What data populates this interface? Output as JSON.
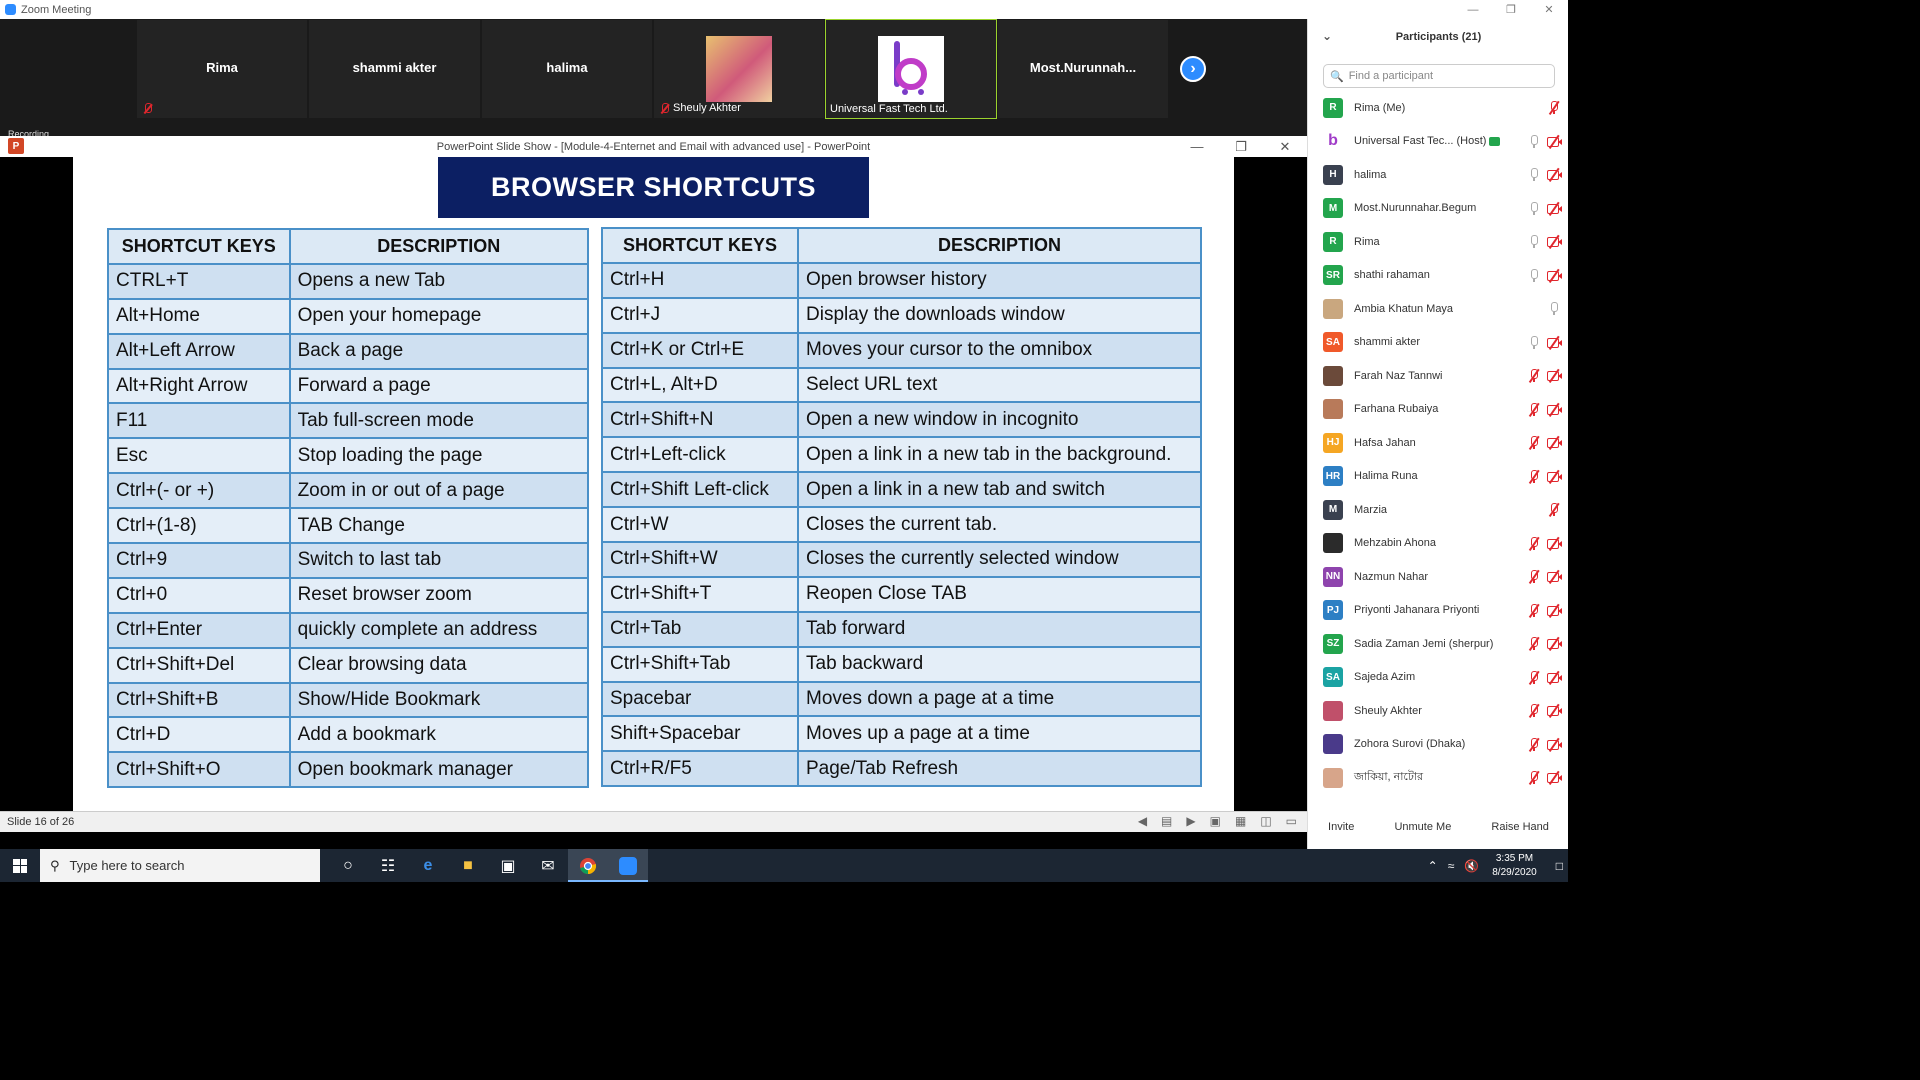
{
  "zoom": {
    "window_title": "Zoom Meeting",
    "recording_label": "Recording",
    "next_icon": "chevron-right-icon",
    "tiles": [
      {
        "name": "Rima",
        "muted": true
      },
      {
        "name": "shammi akter",
        "muted": false
      },
      {
        "name": "halima",
        "muted": false
      },
      {
        "name": "Sheuly Akhter",
        "muted": true,
        "has_photo": true
      },
      {
        "name": "Universal Fast Tech Ltd.",
        "muted": false,
        "has_logo": true,
        "active_speaker": true
      },
      {
        "name": "Most.Nurunnah...",
        "muted": false
      }
    ]
  },
  "powerpoint": {
    "window_title": "PowerPoint Slide Show - [Module-4-Enternet and Email with advanced use] - PowerPoint",
    "status": "Slide 16 of 26",
    "slide": {
      "title": "BROWSER SHORTCUTS",
      "header_keys": "SHORTCUT KEYS",
      "header_desc": "DESCRIPTION",
      "left_rows": [
        [
          "CTRL+T",
          "Opens a new Tab"
        ],
        [
          "Alt+Home",
          "Open your homepage"
        ],
        [
          "Alt+Left Arrow",
          "Back a page"
        ],
        [
          "Alt+Right Arrow",
          "Forward a page"
        ],
        [
          "F11",
          "Tab full-screen mode"
        ],
        [
          "Esc",
          "Stop loading the page"
        ],
        [
          "Ctrl+(- or +)",
          "Zoom in or out of a page"
        ],
        [
          "Ctrl+(1-8)",
          "TAB Change"
        ],
        [
          "Ctrl+9",
          "Switch to last tab"
        ],
        [
          "Ctrl+0",
          "Reset browser zoom"
        ],
        [
          "Ctrl+Enter",
          "quickly complete an address"
        ],
        [
          "Ctrl+Shift+Del",
          "Clear browsing data"
        ],
        [
          "Ctrl+Shift+B",
          "Show/Hide Bookmark"
        ],
        [
          "Ctrl+D",
          "Add a bookmark"
        ],
        [
          "Ctrl+Shift+O",
          "Open bookmark manager"
        ]
      ],
      "right_rows": [
        [
          "Ctrl+H",
          "Open browser history"
        ],
        [
          "Ctrl+J",
          "Display the downloads window"
        ],
        [
          "Ctrl+K or Ctrl+E",
          "Moves your cursor to the omnibox"
        ],
        [
          "Ctrl+L, Alt+D",
          "Select URL text"
        ],
        [
          "Ctrl+Shift+N",
          "Open a new window in incognito"
        ],
        [
          "Ctrl+Left-click",
          "Open a link in a new tab in the background."
        ],
        [
          "Ctrl+Shift Left-click",
          "Open a link in a new tab and switch"
        ],
        [
          "Ctrl+W",
          "Closes the current tab."
        ],
        [
          "Ctrl+Shift+W",
          "Closes the currently selected window"
        ],
        [
          "Ctrl+Shift+T",
          "Reopen Close TAB"
        ],
        [
          "Ctrl+Tab",
          "Tab forward"
        ],
        [
          "Ctrl+Shift+Tab",
          "Tab backward"
        ],
        [
          "Spacebar",
          "Moves down a page at a time"
        ],
        [
          "Shift+Spacebar",
          "Moves up a page at a time"
        ],
        [
          "Ctrl+R/F5",
          "Page/Tab Refresh"
        ]
      ]
    }
  },
  "participants": {
    "title": "Participants (21)",
    "search_placeholder": "Find a participant",
    "list": [
      {
        "name": "Rima (Me)",
        "initials": "R",
        "color": "#23a54d",
        "mic": "muted",
        "cam": "none"
      },
      {
        "name": "Universal Fast Tec... (Host)",
        "initials": "b",
        "color": "#ffffff",
        "mic": "on",
        "cam": "off",
        "host": true
      },
      {
        "name": "halima",
        "initials": "H",
        "color": "#3a4150",
        "mic": "on",
        "cam": "off"
      },
      {
        "name": "Most.Nurunnahar.Begum",
        "initials": "M",
        "color": "#23a54d",
        "mic": "on",
        "cam": "off"
      },
      {
        "name": "Rima",
        "initials": "R",
        "color": "#23a54d",
        "mic": "on",
        "cam": "off"
      },
      {
        "name": "shathi rahaman",
        "initials": "SR",
        "color": "#23a54d",
        "mic": "on",
        "cam": "off"
      },
      {
        "name": "Ambia Khatun Maya",
        "initials": "",
        "color": "#c9a77f",
        "mic": "on",
        "cam": "none"
      },
      {
        "name": "shammi akter",
        "initials": "SA",
        "color": "#f0592a",
        "mic": "on",
        "cam": "off"
      },
      {
        "name": "Farah Naz Tannwi",
        "initials": "",
        "color": "#6b4a3a",
        "mic": "muted",
        "cam": "off"
      },
      {
        "name": "Farhana Rubaiya",
        "initials": "",
        "color": "#b87a5a",
        "mic": "muted",
        "cam": "off"
      },
      {
        "name": "Hafsa Jahan",
        "initials": "HJ",
        "color": "#f5a623",
        "mic": "muted",
        "cam": "off"
      },
      {
        "name": "Halima Runa",
        "initials": "HR",
        "color": "#2d7fc4",
        "mic": "muted",
        "cam": "off"
      },
      {
        "name": "Marzia",
        "initials": "M",
        "color": "#3a4150",
        "mic": "muted",
        "cam": "none"
      },
      {
        "name": "Mehzabin Ahona",
        "initials": "",
        "color": "#2b2b2b",
        "mic": "muted",
        "cam": "off"
      },
      {
        "name": "Nazmun Nahar",
        "initials": "NN",
        "color": "#8e44ad",
        "mic": "muted",
        "cam": "off"
      },
      {
        "name": "Priyonti Jahanara Priyonti",
        "initials": "PJ",
        "color": "#2d7fc4",
        "mic": "muted",
        "cam": "off"
      },
      {
        "name": "Sadia Zaman Jemi (sherpur)",
        "initials": "SZ",
        "color": "#23a54d",
        "mic": "muted",
        "cam": "off"
      },
      {
        "name": "Sajeda Azim",
        "initials": "SA",
        "color": "#1ba3a3",
        "mic": "muted",
        "cam": "off"
      },
      {
        "name": "Sheuly Akhter",
        "initials": "",
        "color": "#c0506a",
        "mic": "muted",
        "cam": "off"
      },
      {
        "name": "Zohora Surovi (Dhaka)",
        "initials": "",
        "color": "#4a3a8a",
        "mic": "muted",
        "cam": "off"
      },
      {
        "name": "জাকিয়া, নাটোর",
        "initials": "",
        "color": "#d7a58a",
        "mic": "muted",
        "cam": "off"
      }
    ],
    "footer": {
      "invite": "Invite",
      "unmute": "Unmute Me",
      "raise_hand": "Raise Hand"
    }
  },
  "taskbar": {
    "search_placeholder": "Type here to search",
    "time": "3:35 PM",
    "date": "8/29/2020",
    "icons": [
      "cortana-icon",
      "task-view-icon",
      "edge-icon",
      "file-explorer-icon",
      "store-icon",
      "mail-icon",
      "chrome-icon",
      "zoom-icon"
    ]
  }
}
